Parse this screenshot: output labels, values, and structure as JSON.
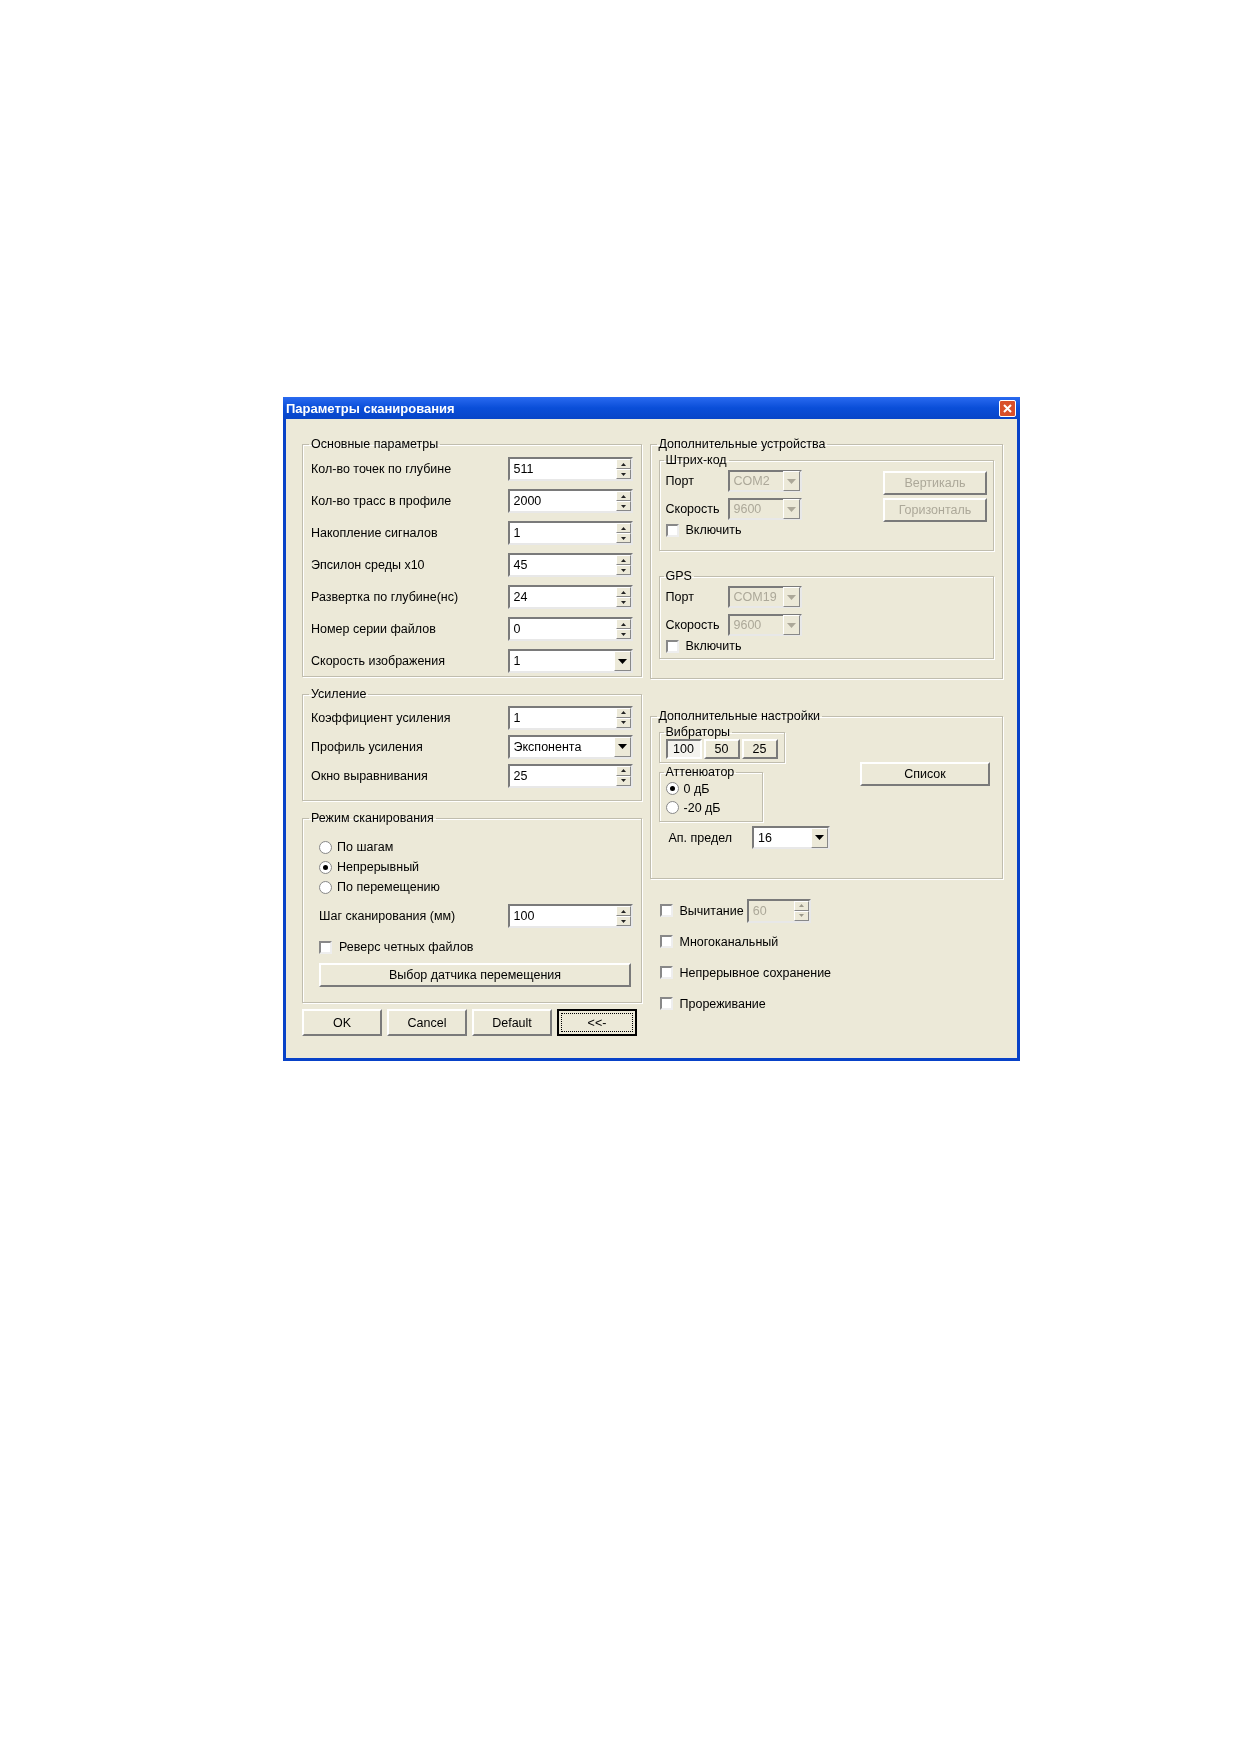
{
  "window": {
    "title": "Параметры сканирования"
  },
  "main_params": {
    "title": "Основные параметры",
    "rows": [
      {
        "kind": "spin",
        "label": "Кол-во точек по глубине",
        "value": "511"
      },
      {
        "kind": "spin",
        "label": "Кол-во трасс в профиле",
        "value": "2000"
      },
      {
        "kind": "spin",
        "label": "Накопление сигналов",
        "value": "1"
      },
      {
        "kind": "spin",
        "label": "Эпсилон среды x10",
        "value": "45"
      },
      {
        "kind": "spin",
        "label": "Развертка по глубине(нс)",
        "value": "24"
      },
      {
        "kind": "spin",
        "label": "Номер серии файлов",
        "value": "0"
      },
      {
        "kind": "dropdown",
        "label": "Скорость изображения",
        "value": "1"
      }
    ]
  },
  "gain": {
    "title": "Усиление",
    "rows": [
      {
        "kind": "spin",
        "label": "Коэффициент усиления",
        "value": "1"
      },
      {
        "kind": "dropdown",
        "label": "Профиль усиления",
        "value": "Экспонента"
      },
      {
        "kind": "spin",
        "label": "Окно выравнивания",
        "value": "25"
      }
    ]
  },
  "scan_mode": {
    "title": "Режим сканирования",
    "options": [
      {
        "label": "По шагам",
        "selected": false
      },
      {
        "label": "Непрерывный",
        "selected": true
      },
      {
        "label": "По перемещению",
        "selected": false
      }
    ],
    "step": {
      "label": "Шаг сканирования (мм)",
      "value": "100"
    },
    "reverse": {
      "label": "Реверс четных файлов",
      "checked": false
    },
    "sensor_button": "Выбор датчика перемещения"
  },
  "buttons": [
    {
      "label": "OK",
      "focused": false
    },
    {
      "label": "Cancel",
      "focused": false
    },
    {
      "label": "Default",
      "focused": false
    },
    {
      "label": "<<-",
      "focused": true
    }
  ],
  "devices": {
    "title": "Дополнительные устройства",
    "groups": [
      {
        "title": "Штрих-код",
        "port": {
          "label": "Порт",
          "value": "COM2",
          "disabled": true
        },
        "speed": {
          "label": "Скорость",
          "value": "9600",
          "disabled": true
        },
        "enable": {
          "label": "Включить",
          "checked": false
        },
        "buttons": [
          {
            "label": "Вертикаль",
            "disabled": true
          },
          {
            "label": "Горизонталь",
            "disabled": true
          }
        ]
      },
      {
        "title": "GPS",
        "port": {
          "label": "Порт",
          "value": "COM19",
          "disabled": true
        },
        "speed": {
          "label": "Скорость",
          "value": "9600",
          "disabled": true
        },
        "enable": {
          "label": "Включить",
          "checked": false
        }
      }
    ]
  },
  "settings": {
    "title": "Дополнительные настройки",
    "vibrators": {
      "title": "Вибраторы",
      "options": [
        {
          "label": "100",
          "selected": true
        },
        {
          "label": "50",
          "selected": false
        },
        {
          "label": "25",
          "selected": false
        }
      ]
    },
    "attenuator": {
      "title": "Аттенюатор",
      "options": [
        {
          "label": "0 дБ",
          "selected": true
        },
        {
          "label": "-20 дБ",
          "selected": false
        }
      ]
    },
    "list_button": "Список",
    "limit": {
      "label": "Ап. предел",
      "value": "16"
    }
  },
  "options": [
    {
      "label": "Вычитание",
      "checked": false,
      "spin": {
        "value": "60",
        "disabled": true
      }
    },
    {
      "label": "Многоканальный",
      "checked": false
    },
    {
      "label": "Непрерывное сохранение",
      "checked": false
    },
    {
      "label": "Прореживание",
      "checked": false
    }
  ]
}
